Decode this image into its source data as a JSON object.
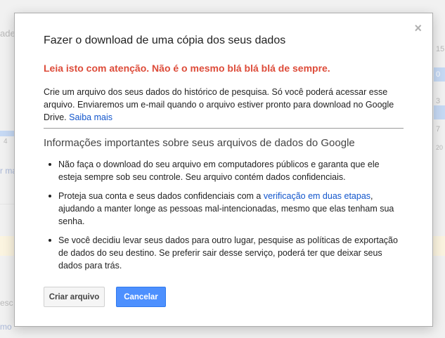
{
  "dialog": {
    "title": "Fazer o download de uma cópia dos seus dados",
    "close_symbol": "×",
    "warning": "Leia isto com atenção. Não é o mesmo blá blá blá de sempre.",
    "intro_text": "Crie um arquivo dos seus dados do histórico de pesquisa. Só você poderá acessar esse arquivo. Enviaremos um e-mail quando o arquivo estiver pronto para download no Google Drive.",
    "intro_link": "Saiba mais",
    "subtitle": "Informações importantes sobre seus arquivos de dados do Google",
    "bullet_1": "Não faça o download do seu arquivo em computadores públicos e garanta que ele esteja sempre sob seu controle. Seu arquivo contém dados confidenciais.",
    "bullet_2_before": "Proteja sua conta e seus dados confidenciais com a",
    "bullet_2_link": "verificação em duas etapas",
    "bullet_2_after": ", ajudando a manter longe as pessoas mal-intencionadas, mesmo que elas tenham sua senha.",
    "bullet_3": "Se você decidiu levar seus dados para outro lugar, pesquise as políticas de exportação de dados do seu destino. Se preferir sair desse serviço, poderá ter que deixar seus dados para trás.",
    "create_button": "Criar arquivo",
    "cancel_button": "Cancelar"
  },
  "background": {
    "frag_left_1": "ade",
    "frag_left_2": "4",
    "frag_left_3": "r ma",
    "frag_left_4": "esc",
    "frag_left_5": "mo",
    "frag_right_1": "15",
    "frag_right_2": "0",
    "frag_right_3": "3",
    "frag_right_4": "7",
    "frag_right_5": "20"
  }
}
